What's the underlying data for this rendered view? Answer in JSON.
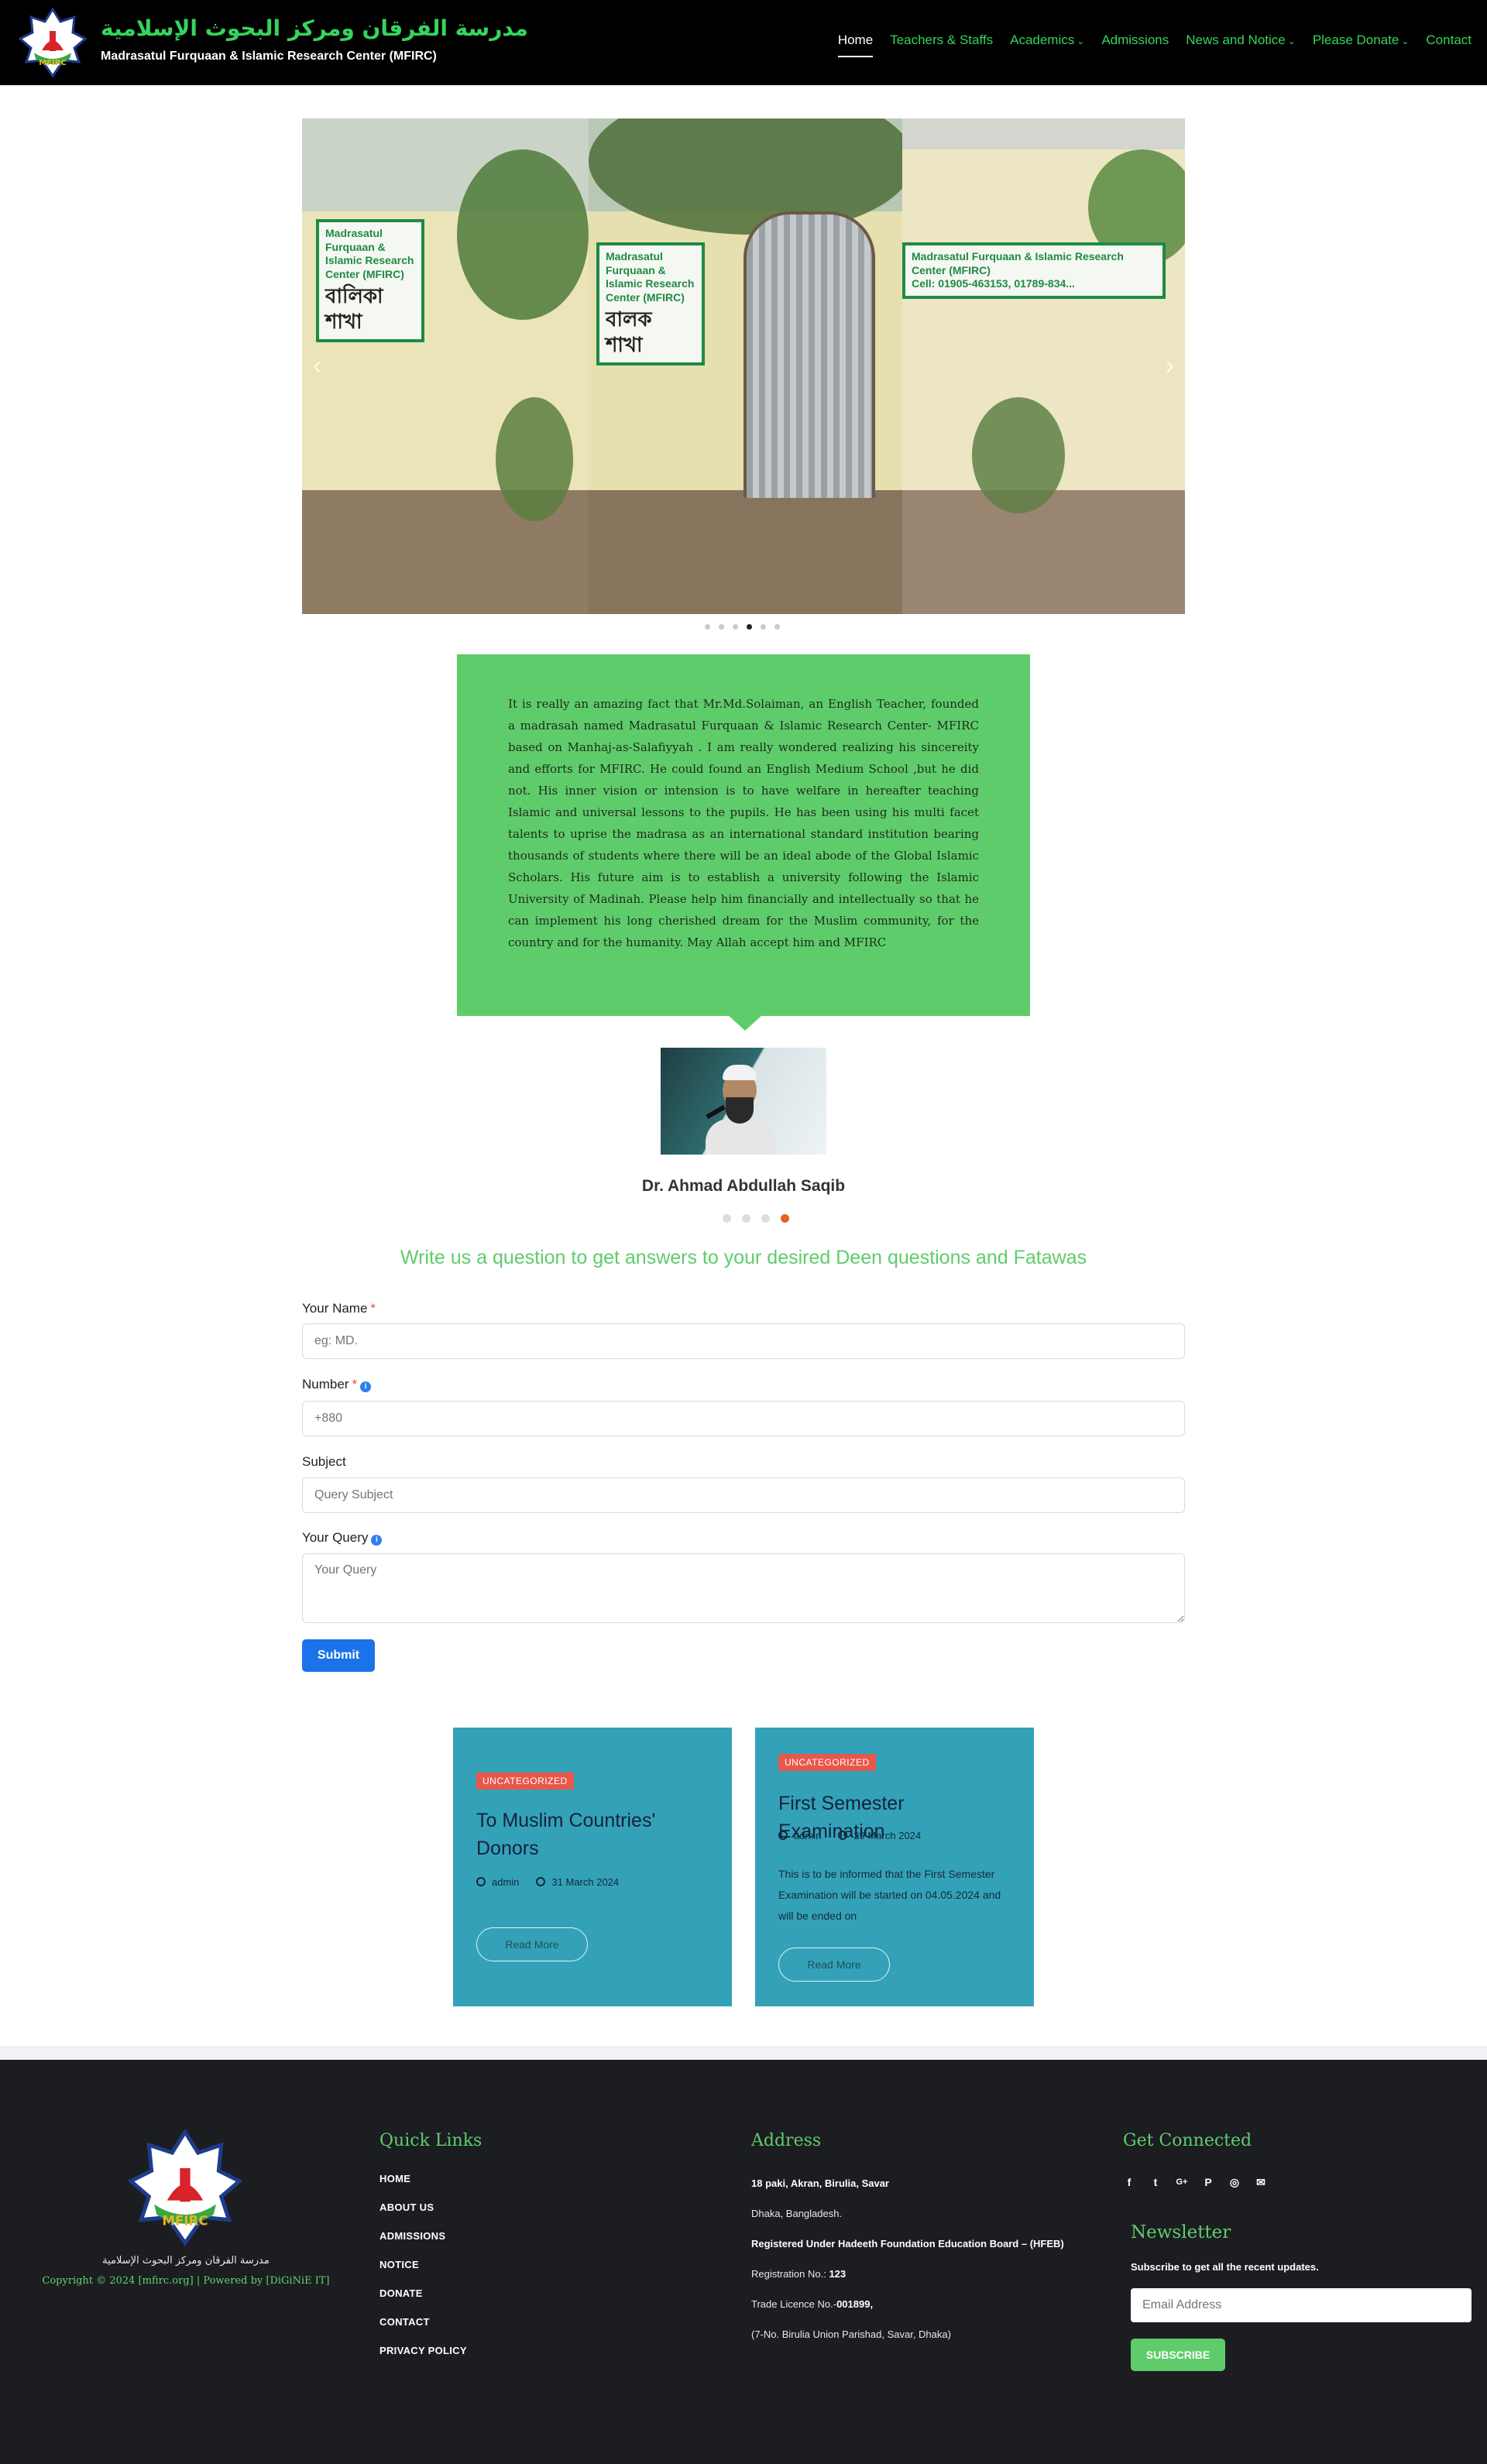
{
  "header": {
    "brand_arabic": "مدرسة الفرقان ومركز البحوث الإسلامية",
    "brand_english": "Madrasatul Furquaan & Islamic Research Center (MFIRC)",
    "logo_text": "MFIRC",
    "nav": [
      {
        "label": "Home",
        "dropdown": false
      },
      {
        "label": "Teachers & Staffs",
        "dropdown": false
      },
      {
        "label": "Academics",
        "dropdown": true
      },
      {
        "label": "Admissions",
        "dropdown": false
      },
      {
        "label": "News and Notice",
        "dropdown": true
      },
      {
        "label": "Please Donate",
        "dropdown": true
      },
      {
        "label": "Contact",
        "dropdown": false
      }
    ],
    "active_nav": "Home"
  },
  "slider": {
    "signs": {
      "left_en": "Madrasatul Furquaan & Islamic Research Center (MFIRC)",
      "left_bn": "বালিকা শাখা",
      "mid_en": "Madrasatul Furquaan & Islamic Research Center (MFIRC)",
      "mid_bn": "বালক শাখা",
      "right_en": "Madrasatul Furquaan & Islamic Research Center (MFIRC)",
      "right_phone": "Cell: 01905-463153, 01789-834..."
    },
    "slide_count": 6,
    "active_slide": 4,
    "prev": "‹",
    "next": "›"
  },
  "testimonial": {
    "text": "It is really an amazing fact that Mr.Md.Solaiman, an English Teacher, founded a madrasah named Madrasatul Furquaan & Islamic Research Center- MFIRC based on Manhaj-as-Salafiyyah . I am really wondered realizing his sincereity and efforts for MFIRC. He could found an English Medium School ,but he did not. His inner vision or intension is to have welfare in hereafter teaching Islamic and universal lessons to the pupils. He has been using his multi facet talents to uprise the madrasa as an international standard institution bearing thousands of students where there will be an ideal abode of the Global Islamic Scholars. His future aim is to establish a university following the Islamic University of Madinah. Please help him financially and intellectually so that he can implement his long cherished dream for the Muslim community, for the country and for the humanity. May Allah accept him and MFIRC",
    "name": "Dr. Ahmad Abdullah Saqib",
    "dot_count": 4,
    "active_dot": 4
  },
  "form": {
    "title": "Write us a question to get answers to your desired Deen questions and Fatawas",
    "name_label": "Your Name",
    "name_placeholder": "eg: MD.",
    "number_label": "Number",
    "number_placeholder": "+880",
    "subject_label": "Subject",
    "subject_placeholder": "Query Subject",
    "query_label": "Your Query",
    "query_placeholder": "Your Query",
    "required_mark": "*",
    "submit_label": "Submit"
  },
  "posts": [
    {
      "category": "UNCATEGORIZED",
      "title": "To Muslim Countries' Donors",
      "author": "admin",
      "date": "31 March 2024",
      "excerpt": "",
      "read_more": "Read More"
    },
    {
      "category": "UNCATEGORIZED",
      "title": "First Semester Examination",
      "author": "admin",
      "date": "29 March 2024",
      "excerpt": "This is to be informed that the First Semester Examination will be started on 04.05.2024 and will be ended on",
      "read_more": "Read More"
    }
  ],
  "footer": {
    "arabic_name": "مدرسة الفرقان ومركز البحوث الإسلامية",
    "copyright": "Copyright © 2024 [mfirc.org] | Powered by [DiGiNiE IT]",
    "quick_links_title": "Quick Links",
    "quick_links": [
      "HOME",
      "ABOUT US",
      "ADMISSIONS",
      "NOTICE",
      "DONATE",
      "CONTACT",
      "PRIVACY POLICY"
    ],
    "address_title": "Address",
    "address_line1": "18 paki, Akran, Birulia, Savar",
    "address_line2": "Dhaka, Bangladesh.",
    "address_line3": "Registered Under Hadeeth Foundation Education Board – (HFEB)",
    "registration_label": "Registration No.:",
    "registration_value": "123",
    "trade_label": "Trade Licence No.-",
    "trade_value": "001899,",
    "address_line6": "(7-No. Birulia Union Parishad, Savar, Dhaka)",
    "connected_title": "Get Connected",
    "social": [
      {
        "name": "facebook-icon",
        "glyph": "f"
      },
      {
        "name": "twitter-icon",
        "glyph": "t"
      },
      {
        "name": "google-plus-icon",
        "glyph": "G+"
      },
      {
        "name": "pinterest-icon",
        "glyph": "P"
      },
      {
        "name": "instagram-icon",
        "glyph": "◎"
      },
      {
        "name": "email-icon",
        "glyph": "✉"
      }
    ],
    "newsletter_title": "Newsletter",
    "newsletter_subtitle": "Subscribe to get all the recent updates.",
    "newsletter_placeholder": "Email Address",
    "subscribe_label": "SUBSCRIBE"
  },
  "colors": {
    "brand_green": "#5fcc6b",
    "nav_green": "#35d45e",
    "post_teal": "#33a2b8",
    "badge_red": "#e8574b",
    "accent_orange": "#e8601c",
    "submit_blue": "#1a73e8",
    "footer_bg": "#1b1d21"
  }
}
